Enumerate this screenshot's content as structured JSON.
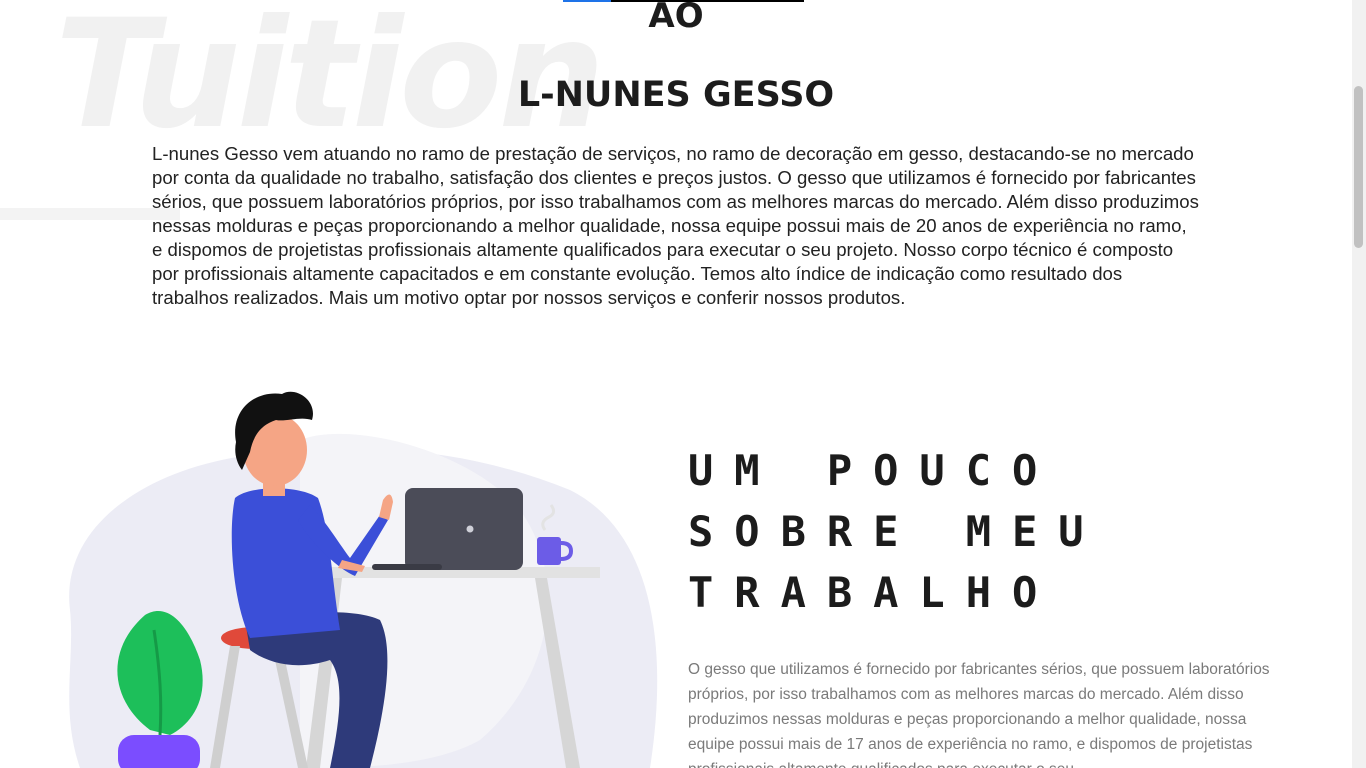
{
  "section_heading_partial": "AO",
  "company": {
    "title": "L-NUNES GESSO",
    "watermark_text": "Tuition",
    "description": "L-nunes Gesso vem atuando no ramo de prestação de serviços, no ramo de decoração em gesso, destacando-se no mercado por conta da qualidade no trabalho, satisfação dos clientes e preços justos. O gesso que utilizamos é fornecido por fabricantes sérios, que possuem laboratórios próprios, por isso trabalhamos com as melhores marcas do mercado. Além disso produzimos nessas molduras e peças proporcionando a melhor qualidade, nossa equipe possui mais de 20 anos de experiência no ramo, e dispomos de projetistas profissionais altamente qualificados para executar o seu projeto. Nosso corpo técnico é composto por profissionais altamente capacitados e em constante evolução. Temos alto índice de indicação como resultado dos trabalhos realizados. Mais um motivo optar por nossos serviços e conferir nossos produtos."
  },
  "about": {
    "title": "UM POUCO SOBRE MEU TRABALHO",
    "text": "O gesso que utilizamos é fornecido por fabricantes sérios, que possuem laboratórios próprios, por isso trabalhamos com as melhores marcas do mercado. Além disso produzimos nessas molduras e peças proporcionando a melhor qualidade, nossa equipe possui mais de 17 anos de experiência no ramo, e dispomos de projetistas profissionais altamente qualificados para executar o seu"
  },
  "illustration": {
    "name": "person-working-on-laptop",
    "accent_color": "#3b4fd8",
    "plant_color": "#1dbf5a",
    "pot_color": "#7b4dff"
  },
  "colors": {
    "heading": "#1c1c1c",
    "body_text": "#222222",
    "muted_text": "#7a7a7a",
    "link_blue": "#1e73e8"
  }
}
